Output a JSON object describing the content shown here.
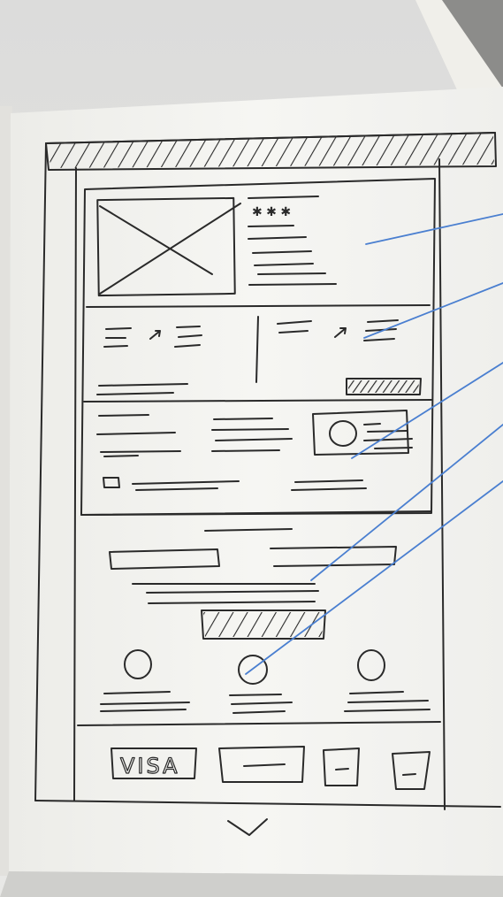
{
  "sketch": {
    "footer_badges": [
      "VISA"
    ],
    "colors": {
      "ink": "#2a2a2a",
      "annotation_lines": "#4a7fd0",
      "paper": "#f4f4f1",
      "table": "#d9d9d7"
    }
  }
}
